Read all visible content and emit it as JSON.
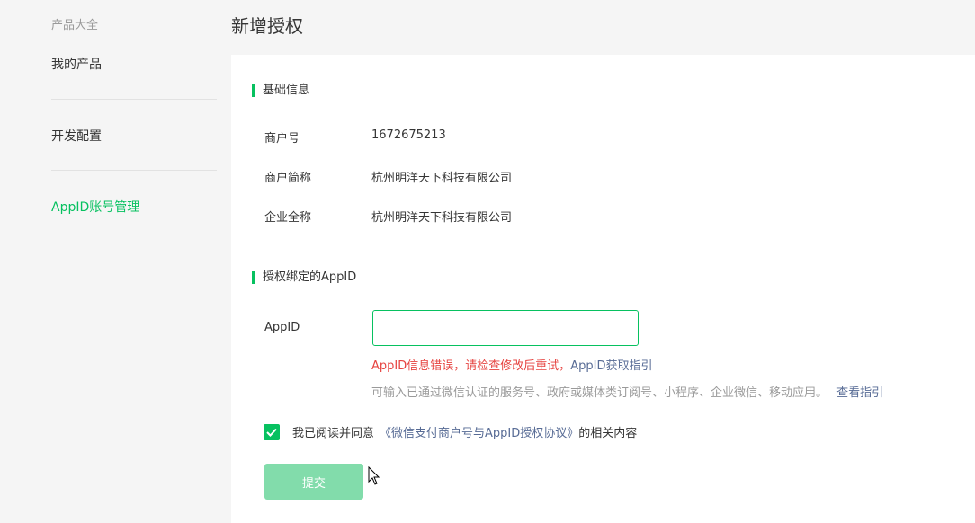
{
  "sidebar": {
    "title": "产品大全",
    "items": [
      {
        "label": "我的产品"
      },
      {
        "label": "开发配置"
      },
      {
        "label": "AppID账号管理"
      }
    ]
  },
  "page": {
    "title": "新增授权"
  },
  "basic_info": {
    "heading": "基础信息",
    "rows": [
      {
        "label": "商户号",
        "value": "1672675213"
      },
      {
        "label": "商户简称",
        "value": "杭州明洋天下科技有限公司"
      },
      {
        "label": "企业全称",
        "value": "杭州明洋天下科技有限公司"
      }
    ]
  },
  "bind_appid": {
    "heading": "授权绑定的AppID",
    "field_label": "AppID",
    "input_value": "",
    "error_text": "AppID信息错误，请检查修改后重试，",
    "error_link": "AppID获取指引",
    "hint_text": "可输入已通过微信认证的服务号、政府或媒体类订阅号、小程序、企业微信、移动应用。",
    "hint_link": "查看指引"
  },
  "agreement": {
    "checked": true,
    "prefix": "我已阅读并同意",
    "link": "《微信支付商户号与AppID授权协议》",
    "suffix": "的相关内容"
  },
  "submit": {
    "label": "提交"
  },
  "colors": {
    "accent": "#07c160",
    "error": "#e64340",
    "link": "#576b95",
    "button_disabled": "#82dcab"
  }
}
